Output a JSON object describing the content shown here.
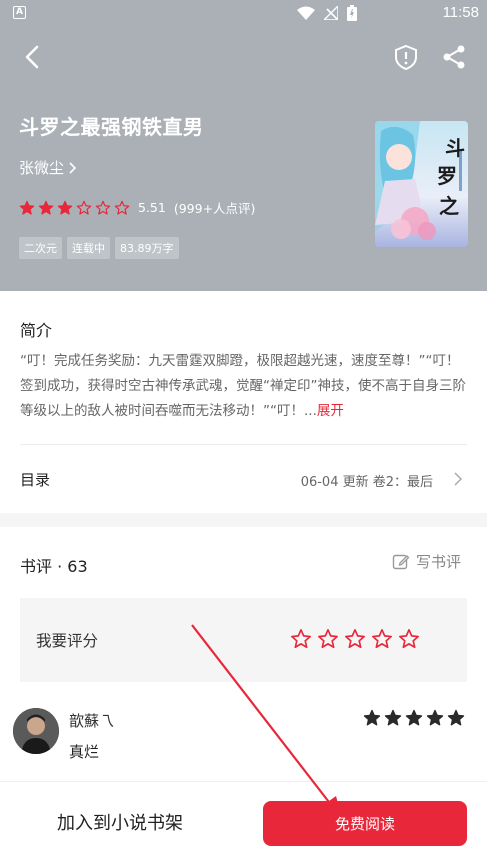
{
  "status_bar": {
    "app_badge": "A",
    "time": "11:58"
  },
  "nav": {
    "back_icon": "back-arrow-icon",
    "report_icon": "shield-alert-icon",
    "share_icon": "share-icon"
  },
  "book": {
    "title": "斗罗之最强钢铁直男",
    "author": "张微尘",
    "rating": 5.51,
    "rating_text": "5.51",
    "rating_count": "(999+人点评)",
    "stars_filled": 3,
    "stars_total": 6,
    "tags": [
      "二次元",
      "连载中",
      "83.89万字"
    ]
  },
  "intro": {
    "title": "简介",
    "text": "“叮！完成任务奖励：九天雷霆双脚蹬，极限超越光速，速度至尊！”“叮！签到成功，获得时空古神传承武魂，觉醒“禅定印”神技，使不高于自身三阶等级以上的敌人被时间吞噬而无法移动！”“叮！...",
    "expand_label": "展开"
  },
  "toc": {
    "label": "目录",
    "meta": "06-04  更新  卷2：最后"
  },
  "reviews": {
    "title": "书评 · 63",
    "write_label": "写书评",
    "rate_prompt": "我要评分",
    "items": [
      {
        "user": "歆蘇乁",
        "text": "真烂",
        "stars": 5
      }
    ]
  },
  "bottom": {
    "add_shelf_label": "加入到小说书架",
    "read_label": "免费阅读"
  },
  "colors": {
    "accent": "#e8283a",
    "header_bg": "#aab0b6",
    "section_bg": "#f5f5f5"
  }
}
